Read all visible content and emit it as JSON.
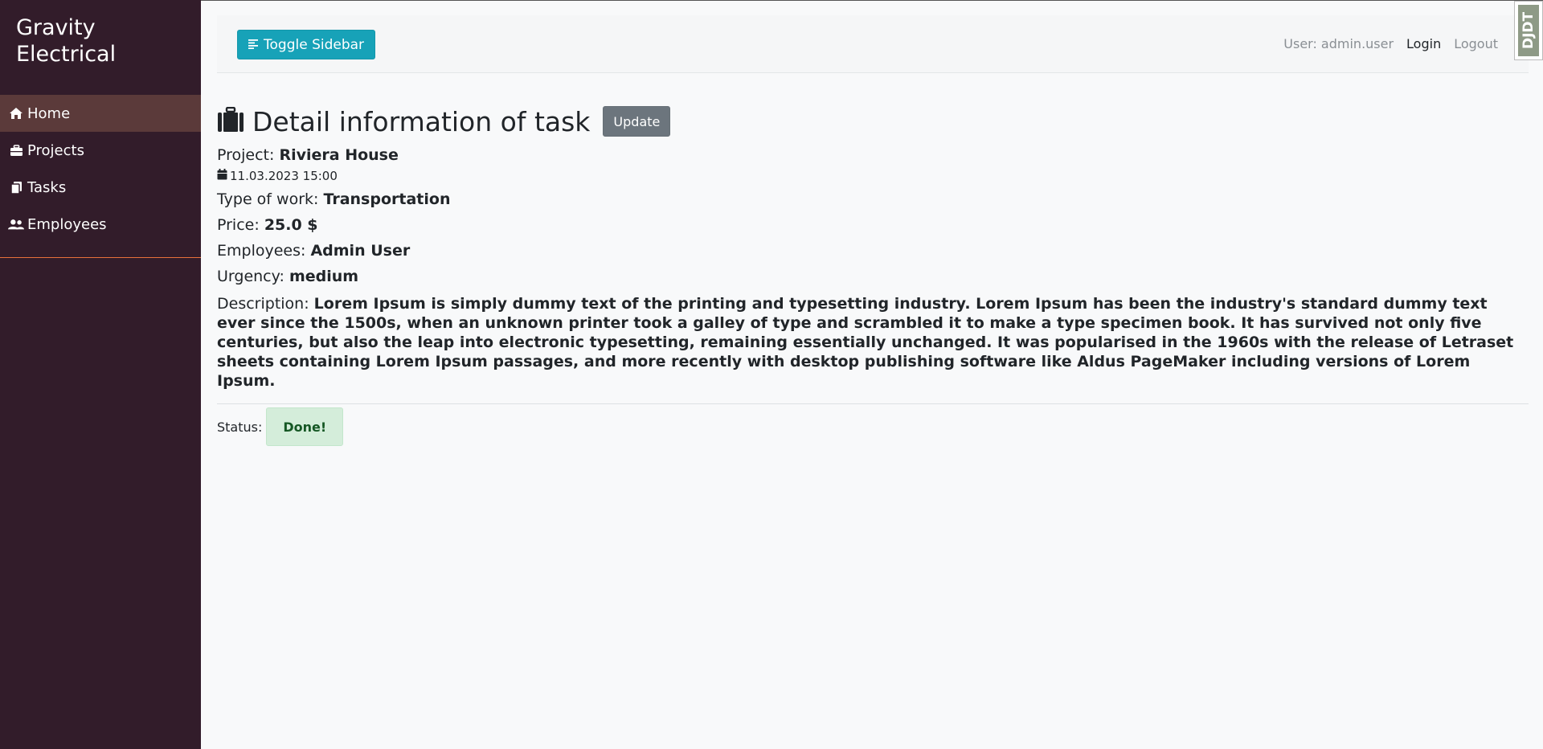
{
  "app": {
    "brand_line1": "Gravity",
    "brand_line2": "Electrical"
  },
  "sidebar": {
    "items": [
      {
        "label": "Home",
        "icon": "home-icon",
        "active": true
      },
      {
        "label": "Projects",
        "icon": "briefcase-icon"
      },
      {
        "label": "Tasks",
        "icon": "copy-icon"
      },
      {
        "label": "Employees",
        "icon": "users-icon"
      }
    ]
  },
  "topbar": {
    "toggle_label": "Toggle Sidebar",
    "user_label": "User: admin.user",
    "login_label": "Login",
    "logout_label": "Logout"
  },
  "debug_toolbar": {
    "label": "DJDT"
  },
  "task": {
    "heading": "Detail information of task",
    "update_label": "Update",
    "project_label": "Project:",
    "project_value": "Riviera House",
    "date": "11.03.2023 15:00",
    "type_label": "Type of work:",
    "type_value": "Transportation",
    "price_label": "Price:",
    "price_value": "25.0 $",
    "employees_label": "Employees:",
    "employees_value": "Admin User",
    "urgency_label": "Urgency:",
    "urgency_value": "medium",
    "description_label": "Description:",
    "description_value": "Lorem Ipsum is simply dummy text of the printing and typesetting industry. Lorem Ipsum has been the industry's standard dummy text ever since the 1500s, when an unknown printer took a galley of type and scrambled it to make a type specimen book. It has survived not only five centuries, but also the leap into electronic typesetting, remaining essentially unchanged. It was popularised in the 1960s with the release of Letraset sheets containing Lorem Ipsum passages, and more recently with desktop publishing software like Aldus PageMaker including versions of Lorem Ipsum.",
    "status_label": "Status:",
    "status_value": "Done!"
  },
  "colors": {
    "sidebar_bg": "#321c2a",
    "active_item_bg": "#5b3a3a",
    "toggle_btn": "#17a2b8",
    "update_btn": "#6c757d",
    "status_bg": "#d4edda",
    "status_text": "#155724"
  }
}
